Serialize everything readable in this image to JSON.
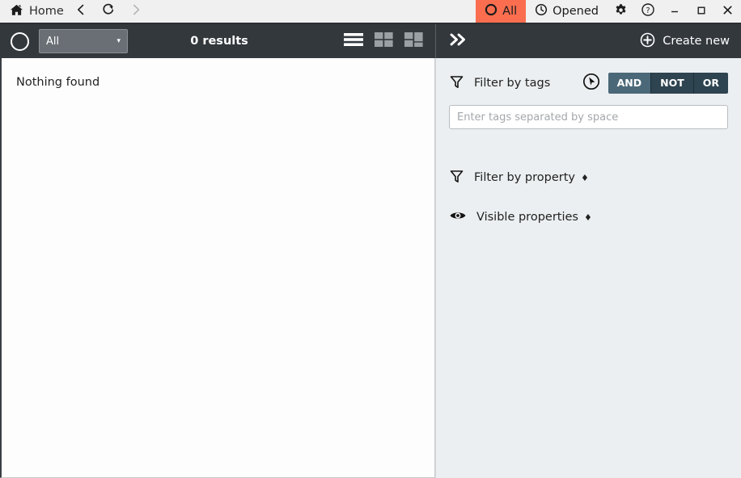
{
  "titlebar": {
    "home_label": "Home",
    "home_icon": "home-icon",
    "back_icon": "chevron-left-icon",
    "refresh_icon": "refresh-icon",
    "forward_icon": "chevron-right-icon",
    "tabs": [
      {
        "label": "All",
        "icon": "circle-outline-icon",
        "active": true
      },
      {
        "label": "Opened",
        "icon": "clock-icon",
        "active": false
      }
    ],
    "settings_icon": "gear-icon",
    "help_icon": "help-circle-icon",
    "minimize_icon": "minimize-icon",
    "maximize_icon": "maximize-icon",
    "close_icon": "close-icon",
    "accent_color": "#fa6e4f",
    "bg_color": "#f0f0f0"
  },
  "toolbar": {
    "status_icon": "circle-outline-icon",
    "filter_select_value": "All",
    "filter_select_caret": "▾",
    "results_text": "0 results",
    "view_modes": [
      {
        "name": "list-view",
        "active": true
      },
      {
        "name": "grid-view",
        "active": false
      },
      {
        "name": "mosaic-view",
        "active": false
      }
    ],
    "bg_color": "#33383d"
  },
  "content": {
    "empty_message": "Nothing found"
  },
  "right_panel": {
    "collapse_icon": "double-chevron-right-icon",
    "create_new_label": "Create new",
    "create_new_icon": "plus-circle-icon",
    "filter_tags": {
      "icon": "funnel-icon",
      "label": "Filter by tags",
      "cursor_icon": "cursor-circle-icon",
      "logic_buttons": [
        {
          "label": "AND",
          "active": true
        },
        {
          "label": "NOT",
          "active": false
        },
        {
          "label": "OR",
          "active": false
        }
      ],
      "input_value": "",
      "input_placeholder": "Enter tags separated by space"
    },
    "filter_property": {
      "icon": "funnel-icon",
      "label": "Filter by property",
      "marker": "♦"
    },
    "visible_properties": {
      "icon": "eye-icon",
      "label": "Visible properties",
      "marker": "♦"
    },
    "bg_color": "#eceff1",
    "active_logic_color": "#4a6878"
  }
}
